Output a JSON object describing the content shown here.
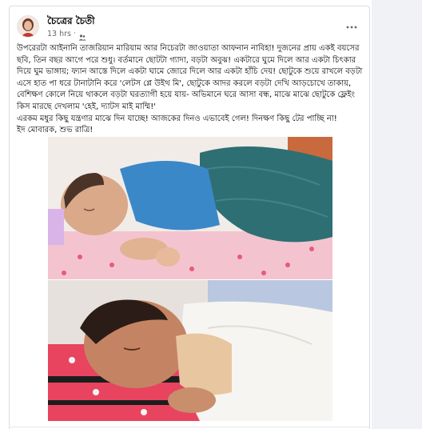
{
  "post": {
    "author": "চৈত্রের চৈতী",
    "timestamp": "13 hrs",
    "privacy_icon": "friends-icon",
    "more_icon": "more-horizontal-icon",
    "paragraphs": [
      "উপরেরটা আইনানি তাজরিয়ান মারিয়াম আর নিচেরটা জাওয়াতা আফনান নাবিহা! দুজনের প্রায় একই বয়সের ছবি, তিন বছর আগে পরে শুধু। বর্তমানে ছোটটা গ্যাদা, বড়টা অবুঝ! একটারে ঘুমে দিলে আর একটা চিৎকার দিয়ে ঘুম ভাঙ্গায়; ফ্যান আস্তে দিলে একটা ঘামে জোরে দিলে আর একটা হাঁচি দেয়! ছোটুকে শুয়ে রাখলে বড়টা এসে হাত পা ধরে টানাটানি করে 'লেটস প্লে উইথ মি', ছোটুকে আদর করলে বড়টা দেখি আড়চোখে তাকায়, বেশিক্ষণ কোলে নিয়ে থাকলে বড়টা ঘরত্যাগী হয়ে যায়- অভিমানে ঘরে আসা বন্ধ, মাঝে মাঝে ছোটুকে ফ্লেইং কিস মারছে দেখলাম 'হেই, দ্যাটস মাই মাম্মি!'",
      "এরকম মধুর কিছু যন্ত্রণার মাঝে দিন যাচ্ছে! আজকের দিনও এভাবেই গেল! দিনক্ষণ কিছু টের পাচ্ছি না!",
      "ইদ মোবারক, শুভ রাত্রি!"
    ],
    "photos": [
      {
        "name": "photo-top",
        "subject": "sleeping baby in blue shirt under green blanket"
      },
      {
        "name": "photo-bottom",
        "subject": "sleeping baby on pink floral bedding"
      }
    ]
  },
  "colors": {
    "background": "#ffffff",
    "feed_background": "#f0f2f5",
    "text_primary": "#050505",
    "text_secondary": "#65676b"
  }
}
